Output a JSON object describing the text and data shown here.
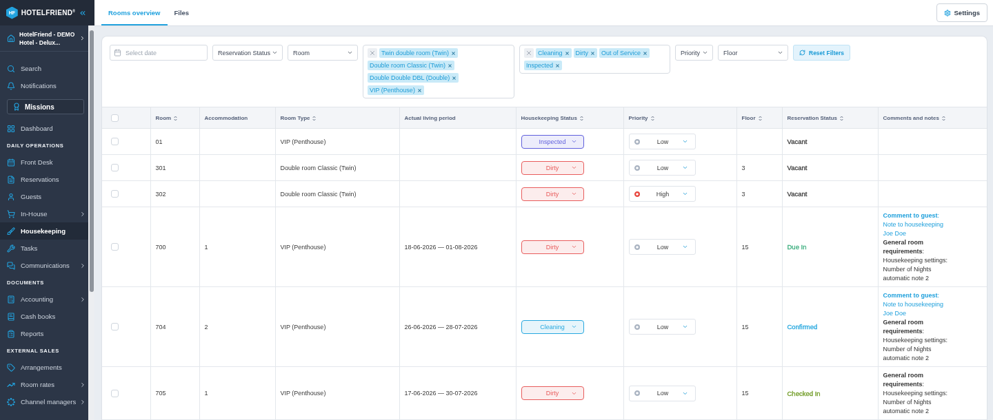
{
  "sidebar": {
    "logo": {
      "mark": "HF",
      "name": "HOTELFRIEND$^{®}$"
    },
    "hotel": "HotelFriend - DEMO Hotel - Delux...",
    "nav": [
      {
        "kind": "item",
        "label": "Search",
        "selected": false,
        "expandable": false
      },
      {
        "kind": "item",
        "label": "Notifications",
        "selected": false,
        "expandable": false
      },
      {
        "kind": "featured",
        "label": "Missions",
        "selected": false,
        "expandable": false
      },
      {
        "kind": "item",
        "label": "Dashboard",
        "selected": false,
        "expandable": false
      },
      {
        "kind": "section",
        "label": "DAILY OPERATIONS"
      },
      {
        "kind": "item",
        "label": "Front Desk",
        "selected": false,
        "expandable": false
      },
      {
        "kind": "item",
        "label": "Reservations",
        "selected": false,
        "expandable": false
      },
      {
        "kind": "item",
        "label": "Guests",
        "selected": false,
        "expandable": false
      },
      {
        "kind": "item",
        "label": "In-House",
        "selected": false,
        "expandable": true
      },
      {
        "kind": "item",
        "label": "Housekeeping",
        "selected": true,
        "expandable": false
      },
      {
        "kind": "item",
        "label": "Tasks",
        "selected": false,
        "expandable": false
      },
      {
        "kind": "item",
        "label": "Communications",
        "selected": false,
        "expandable": true
      },
      {
        "kind": "section",
        "label": "DOCUMENTS"
      },
      {
        "kind": "item",
        "label": "Accounting",
        "selected": false,
        "expandable": true
      },
      {
        "kind": "item",
        "label": "Cash books",
        "selected": false,
        "expandable": false
      },
      {
        "kind": "item",
        "label": "Reports",
        "selected": false,
        "expandable": false
      },
      {
        "kind": "section",
        "label": "EXTERNAL SALES"
      },
      {
        "kind": "item",
        "label": "Arrangements",
        "selected": false,
        "expandable": false
      },
      {
        "kind": "item",
        "label": "Room rates",
        "selected": false,
        "expandable": true
      },
      {
        "kind": "item",
        "label": "Channel managers",
        "selected": false,
        "expandable": true
      }
    ]
  },
  "tabs": [
    {
      "label": "Rooms overview",
      "selected": true
    },
    {
      "label": "Files",
      "selected": false
    }
  ],
  "settings_button": {
    "label": "Settings"
  },
  "filters": [
    {
      "kind": "date",
      "placeholder": "Select date"
    },
    {
      "kind": "select",
      "label": "Reservation Status"
    },
    {
      "kind": "select",
      "label": "Room"
    },
    {
      "kind": "multi",
      "chips": [
        "Twin double room (Twin)",
        "Double room Classic (Twin)",
        "Double Double DBL (Double)",
        "VIP (Penthouse)"
      ]
    },
    {
      "kind": "multi",
      "chips": [
        "Cleaning",
        "Dirty",
        "Out of Service",
        "Inspected"
      ]
    },
    {
      "kind": "select",
      "label": "Priority"
    },
    {
      "kind": "select",
      "label": "Floor"
    },
    {
      "kind": "button",
      "label": "Reset Filters"
    }
  ],
  "table": {
    "select_all": {
      "checked": false
    },
    "columns": [
      {
        "label": "Room",
        "sortable": true
      },
      {
        "label": "Accommodation",
        "sortable": false
      },
      {
        "label": "Room Type",
        "sortable": true
      },
      {
        "label": "Actual living period",
        "sortable": false
      },
      {
        "label": "Housekeeping Status",
        "sortable": true
      },
      {
        "label": "Priority",
        "sortable": true
      },
      {
        "label": "Floor",
        "sortable": true
      },
      {
        "label": "Reservation Status",
        "sortable": true
      },
      {
        "label": "Comments and notes",
        "sortable": true
      }
    ],
    "rows": [
      {
        "checked": false,
        "room": "01",
        "room_type": "VIP (Penthouse)",
        "housekeeping_status": {
          "label": "Inspected",
          "color": "#5f5fdc"
        },
        "priority": {
          "label": "Low",
          "color": "#a9b3c1"
        },
        "reservation_status": {
          "label": "Vacant",
          "color": "#3a3a3a"
        }
      },
      {
        "checked": false,
        "room": "301",
        "room_type": "Double room Classic (Twin)",
        "housekeeping_status": {
          "label": "Dirty",
          "color": "#e85c5c"
        },
        "priority": {
          "label": "Low",
          "color": "#a9b3c1"
        },
        "floor": "3",
        "reservation_status": {
          "label": "Vacant",
          "color": "#3a3a3a"
        }
      },
      {
        "checked": false,
        "room": "302",
        "room_type": "Double room Classic (Twin)",
        "housekeeping_status": {
          "label": "Dirty",
          "color": "#e85c5c"
        },
        "priority": {
          "label": "High",
          "color": "#e8453c"
        },
        "floor": "3",
        "reservation_status": {
          "label": "Vacant",
          "color": "#3a3a3a"
        }
      },
      {
        "checked": false,
        "room": "700",
        "accommodation": "1",
        "room_type": "VIP (Penthouse)",
        "living_period": "18-06-2026 — 01-08-2026",
        "housekeeping_status": {
          "label": "Dirty",
          "color": "#e85c5c"
        },
        "priority": {
          "label": "Low",
          "color": "#a9b3c1"
        },
        "floor": "15",
        "reservation_status": {
          "label": "Due In",
          "color": "#3bae7e"
        },
        "notes": [
          {
            "kind": "guest",
            "heading": "**Comment to guest**:",
            "lines": [
              "Note to housekeeping",
              "Joe Doe"
            ]
          },
          {
            "kind": "room",
            "heading": "**General room requirements**:",
            "lines": [
              "Housekeeping settings:",
              "Number of Nights",
              "automatic note 2"
            ]
          }
        ]
      },
      {
        "checked": false,
        "room": "704",
        "accommodation": "2",
        "room_type": "VIP (Penthouse)",
        "living_period": "26-06-2026 — 28-07-2026",
        "housekeeping_status": {
          "label": "Cleaning",
          "color": "#27a8df"
        },
        "priority": {
          "label": "Low",
          "color": "#a9b3c1"
        },
        "floor": "15",
        "reservation_status": {
          "label": "Confirmed",
          "color": "#27a8df"
        },
        "notes": [
          {
            "kind": "guest",
            "heading": "**Comment to guest**:",
            "lines": [
              "Note to housekeeping",
              "Joe Doe"
            ]
          },
          {
            "kind": "room",
            "heading": "**General room requirements**:",
            "lines": [
              "Housekeeping settings:",
              "Number of Nights",
              "automatic note 2"
            ]
          }
        ]
      },
      {
        "checked": false,
        "room": "705",
        "accommodation": "1",
        "room_type": "VIP (Penthouse)",
        "living_period": "17-06-2026 — 30-07-2026",
        "housekeeping_status": {
          "label": "Dirty",
          "color": "#e85c5c"
        },
        "priority": {
          "label": "Low",
          "color": "#a9b3c1"
        },
        "floor": "15",
        "reservation_status": {
          "label": "Checked In",
          "color": "#6e9a22"
        },
        "notes": [
          {
            "kind": "room",
            "heading": "**General room requirements**:",
            "lines": [
              "Housekeeping settings:",
              "Number of Nights",
              "automatic note 2"
            ]
          }
        ]
      }
    ]
  }
}
